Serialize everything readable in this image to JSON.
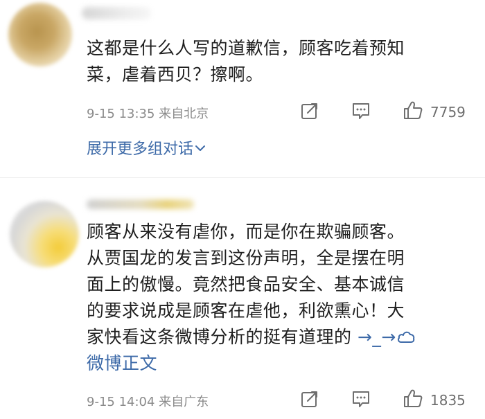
{
  "comments": [
    {
      "text_lines": [
        "这都是什么人写的道歉信，顾客吃着预知",
        "菜，虐着西贝？擦啊。"
      ],
      "time_location": "9-15 13:35 来自北京",
      "likes": "7759",
      "expand_label": "展开更多组对话"
    },
    {
      "text_lines": [
        "顾客从来没有虐你，而是你在欺骗顾客。",
        "从贾国龙的发言到这份声明，全是摆在明",
        "面上的傲慢。竟然把食品安全、基本诚信",
        "的要求说成是顾客在虐他，利欲熏心！大",
        "家快看这条微博分析的挺有道理的"
      ],
      "link_arrow": "→_→",
      "link_label": "微博正文",
      "time_location": "9-15 14:04 来自广东",
      "likes": "1835"
    }
  ],
  "icons": {
    "share": "share-icon",
    "comment": "comment-icon",
    "like": "thumbs-up-icon",
    "expand": "chevron-down-icon",
    "link": "weibo-cloud-icon"
  },
  "colors": {
    "link": "#3d6aa8",
    "meta": "#8a8a8a",
    "text": "#1f1f1f"
  }
}
